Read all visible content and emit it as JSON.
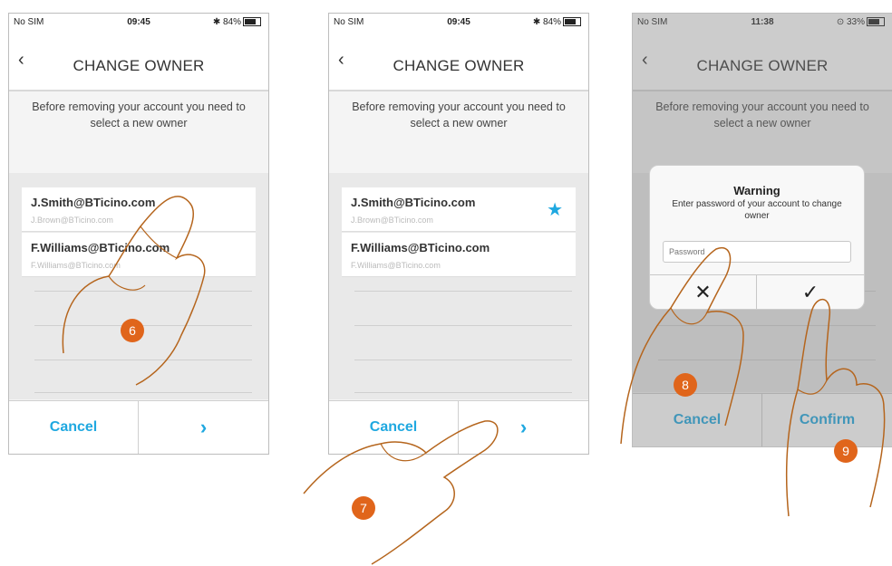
{
  "phones": [
    {
      "status": {
        "carrier": "No SIM",
        "time": "09:45",
        "battery": "84%"
      },
      "header": {
        "back": "‹",
        "title": "CHANGE OWNER"
      },
      "subtitle": "Before removing your account you need to select a new owner",
      "rows": [
        {
          "email": "J.Smith@BTicino.com",
          "sub": "J.Brown@BTicino.com"
        },
        {
          "email": "F.Williams@BTicino.com",
          "sub": "F.Williams@BTicino.com"
        }
      ],
      "buttons": {
        "cancel": "Cancel",
        "next": "›"
      },
      "step": "6"
    },
    {
      "status": {
        "carrier": "No SIM",
        "time": "09:45",
        "battery": "84%"
      },
      "header": {
        "back": "‹",
        "title": "CHANGE OWNER"
      },
      "subtitle": "Before removing your account you need to select a new owner",
      "rows": [
        {
          "email": "J.Smith@BTicino.com",
          "sub": "J.Brown@BTicino.com",
          "selected": true
        },
        {
          "email": "F.Williams@BTicino.com",
          "sub": "F.Williams@BTicino.com"
        }
      ],
      "buttons": {
        "cancel": "Cancel",
        "next": "›"
      },
      "step": "7"
    },
    {
      "status": {
        "carrier": "No SIM",
        "time": "11:38",
        "battery": "33%"
      },
      "header": {
        "back": "‹",
        "title": "CHANGE OWNER"
      },
      "subtitle": "Before removing your account you need to select a new owner",
      "dialog": {
        "title": "Warning",
        "message": "Enter password of your account to change owner",
        "placeholder": "Password",
        "cancel_icon": "close-icon",
        "confirm_icon": "check-icon"
      },
      "buttons": {
        "cancel": "Cancel",
        "confirm": "Confirm"
      },
      "steps": [
        "8",
        "9"
      ]
    }
  ],
  "colors": {
    "accent": "#1fa8e0",
    "badge": "#e0651b",
    "hand": "#b5651d"
  }
}
